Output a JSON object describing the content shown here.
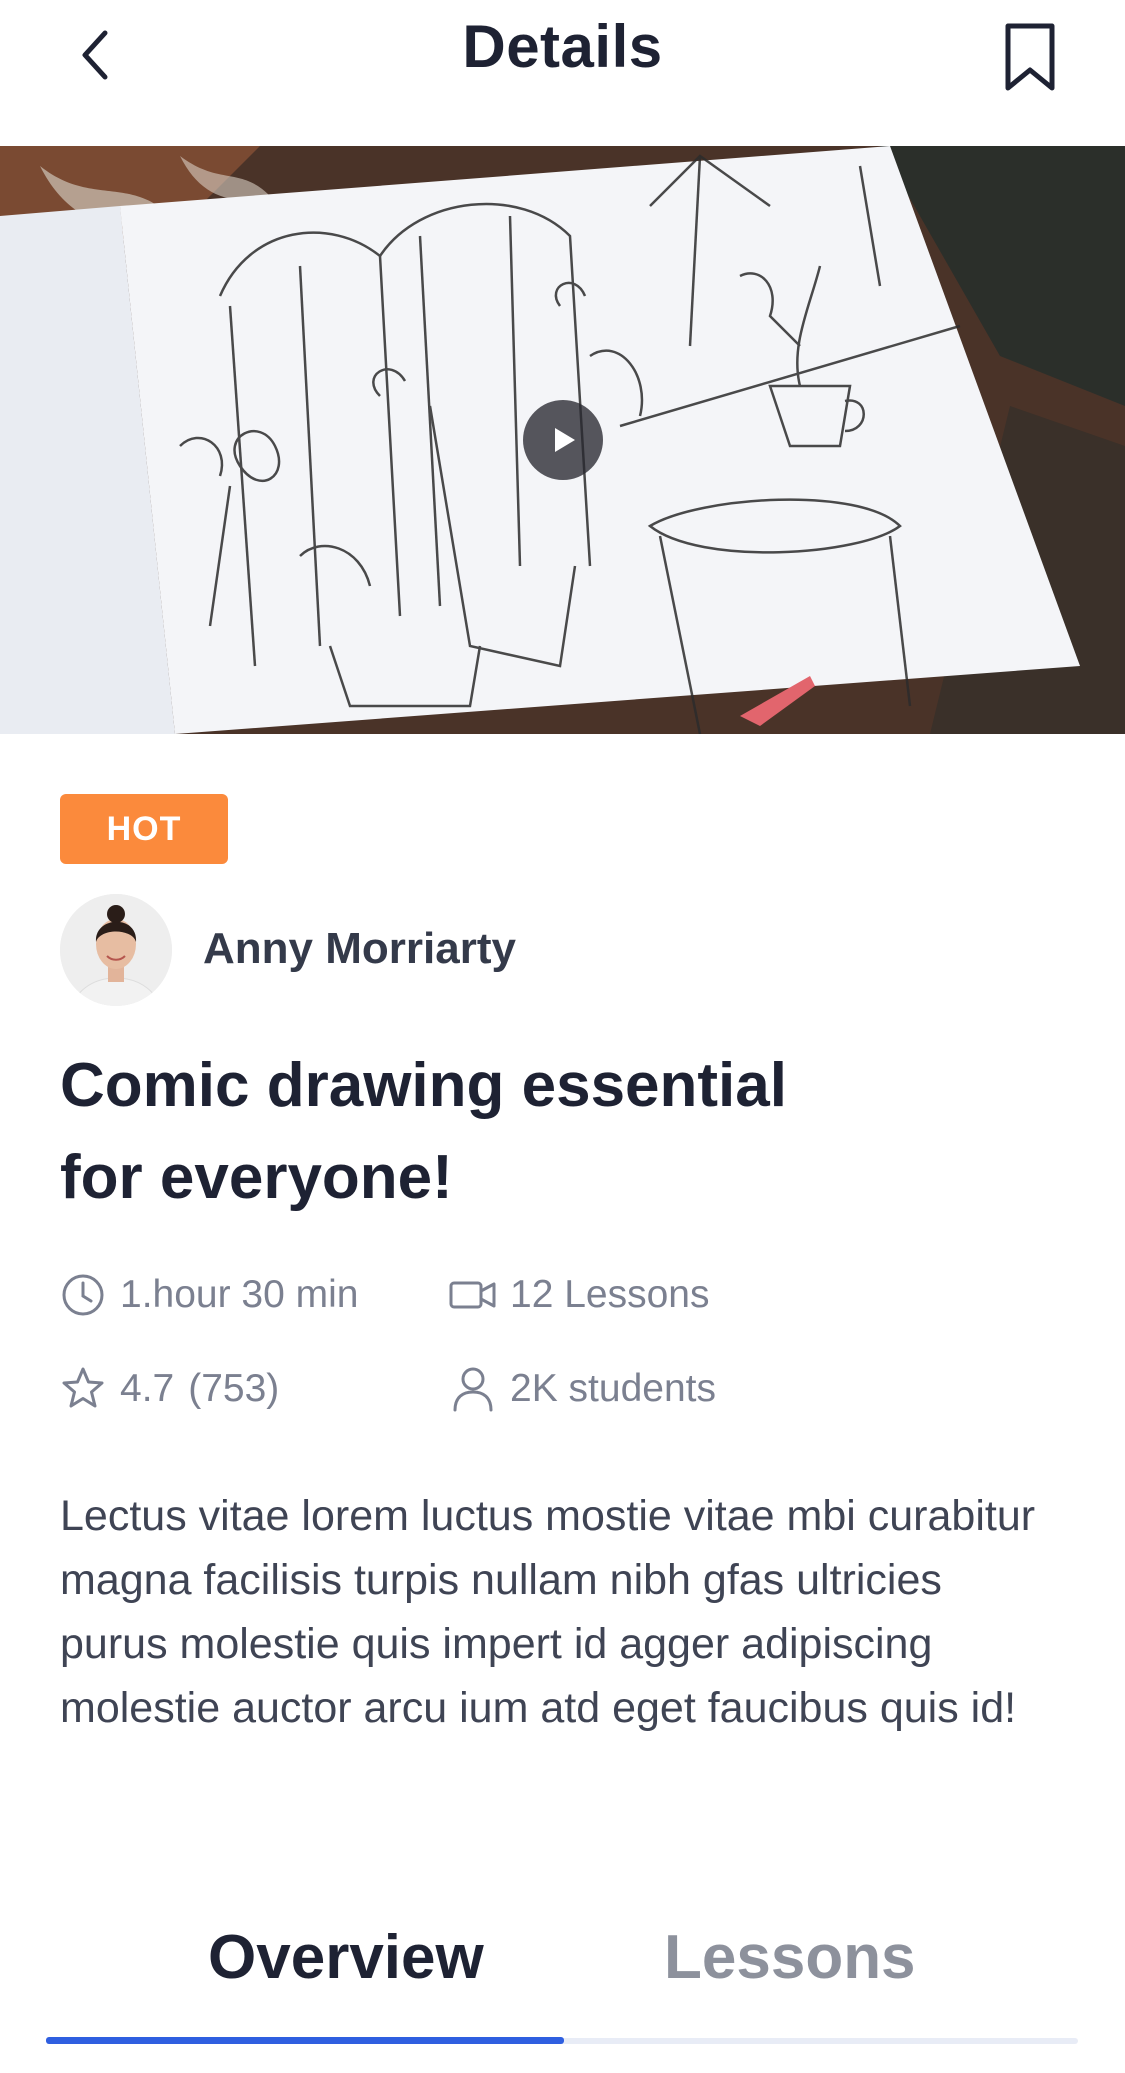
{
  "header": {
    "title": "Details",
    "back_icon": "chevron-left-icon",
    "bookmark_icon": "bookmark-icon"
  },
  "hero": {
    "play_icon": "play-icon"
  },
  "badge": {
    "label": "HOT",
    "color": "#fb8a3c"
  },
  "author": {
    "name": "Anny Morriarty"
  },
  "course": {
    "title_line1": "Comic drawing essential",
    "title_line2": "for everyone!",
    "duration": "1.hour 30 min",
    "lessons": "12 Lessons",
    "rating": "4.7",
    "reviews": "(753)",
    "students": "2K students",
    "description": "Lectus vitae lorem luctus mostie vitae mbi curabitur magna facilisis turpis nullam nibh gfas ultricies purus molestie quis impert id agger adipiscing molestie auctor arcu ium atd eget faucibus quis id!"
  },
  "tabs": [
    {
      "label": "Overview",
      "active": true
    },
    {
      "label": "Lessons",
      "active": false
    }
  ],
  "colors": {
    "accent": "#2f5fe0",
    "heading": "#1e2233",
    "muted": "#7b8090"
  }
}
